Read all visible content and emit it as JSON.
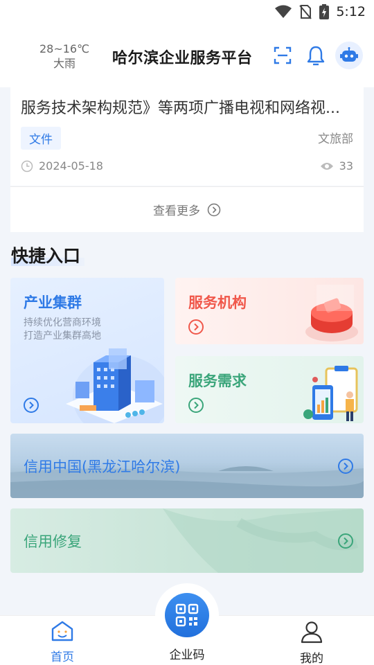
{
  "status_bar": {
    "time": "5:12"
  },
  "header": {
    "temperature": "28~16℃",
    "weather": "大雨",
    "title": "哈尔滨企业服务平台"
  },
  "news": {
    "title": "服务技术架构规范》等两项广播电视和网络视...",
    "tag": "文件",
    "source": "文旅部",
    "date": "2024-05-18",
    "views": "33",
    "more_label": "查看更多"
  },
  "quick_entry": {
    "title": "快捷入口",
    "tiles": [
      {
        "label": "产业集群",
        "sub1": "持续优化营商环境",
        "sub2": "打造产业集群高地",
        "color": "#2f7ae6"
      },
      {
        "label": "服务机构",
        "color": "#f0574a"
      },
      {
        "label": "服务需求",
        "color": "#3aa57a"
      }
    ],
    "banners": [
      {
        "label": "信用中国(黑龙江哈尔滨)",
        "color": "#2f7ae6"
      },
      {
        "label": "信用修复",
        "color": "#3aa57a"
      }
    ]
  },
  "bottom_nav": {
    "home": "首页",
    "code": "企业码",
    "mine": "我的"
  }
}
